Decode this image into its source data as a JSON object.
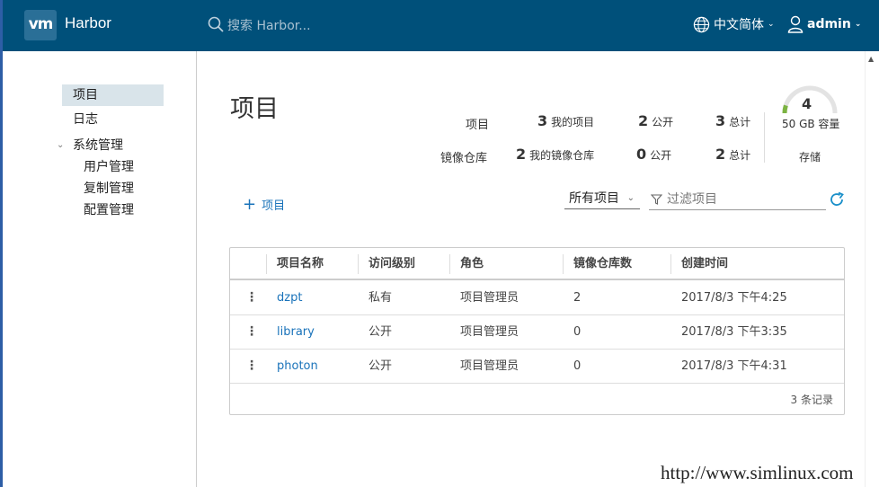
{
  "app": {
    "logo": "vm",
    "brand": "Harbor"
  },
  "header": {
    "search_placeholder": "搜索 Harbor...",
    "language": "中文简体",
    "user": "admin"
  },
  "sidebar": {
    "items": [
      {
        "label": "项目"
      },
      {
        "label": "日志"
      },
      {
        "label": "系统管理"
      }
    ],
    "subitems": [
      {
        "label": "用户管理"
      },
      {
        "label": "复制管理"
      },
      {
        "label": "配置管理"
      }
    ]
  },
  "page": {
    "title": "项目"
  },
  "summary": {
    "projects": {
      "label": "项目",
      "mine_num": "3",
      "mine_label": "我的项目",
      "public_num": "2",
      "public_label": "公开",
      "total_num": "3",
      "total_label": "总计"
    },
    "repos": {
      "label": "镜像仓库",
      "mine_num": "2",
      "mine_label": "我的镜像仓库",
      "public_num": "0",
      "public_label": "公开",
      "total_num": "2",
      "total_label": "总计"
    },
    "storage": {
      "count": "4",
      "capacity": "50 GB 容量",
      "label": "存储",
      "gauge_fraction": 0.1
    }
  },
  "toolbar": {
    "add_label": "项目",
    "select_value": "所有项目",
    "filter_placeholder": "过滤项目"
  },
  "table": {
    "columns": [
      "项目名称",
      "访问级别",
      "角色",
      "镜像仓库数",
      "创建时间"
    ],
    "rows": [
      {
        "name": "dzpt",
        "access": "私有",
        "role": "项目管理员",
        "repos": "2",
        "created": "2017/8/3 下午4:25"
      },
      {
        "name": "library",
        "access": "公开",
        "role": "项目管理员",
        "repos": "0",
        "created": "2017/8/3 下午3:35"
      },
      {
        "name": "photon",
        "access": "公开",
        "role": "项目管理员",
        "repos": "0",
        "created": "2017/8/3 下午4:31"
      }
    ],
    "footer": "3 条记录"
  },
  "watermark": "http://www.simlinux.com",
  "colors": {
    "header": "#00507a",
    "link": "#1a73ba",
    "gauge": "#7cb342"
  }
}
